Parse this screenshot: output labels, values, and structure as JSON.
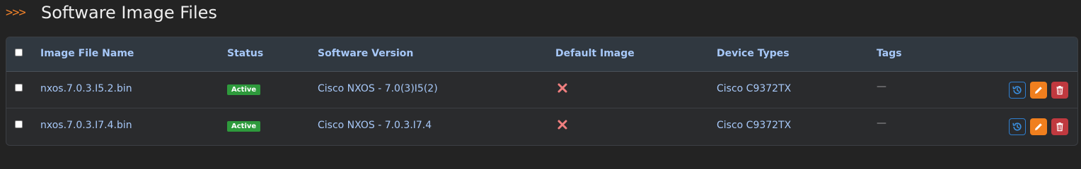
{
  "header": {
    "chevrons": ">>>",
    "title": "Software Image Files"
  },
  "table": {
    "columns": [
      "Image File Name",
      "Status",
      "Software Version",
      "Default Image",
      "Device Types",
      "Tags"
    ],
    "rows": [
      {
        "image_file_name": "nxos.7.0.3.I5.2.bin",
        "status": "Active",
        "software_version": "Cisco NXOS - 7.0(3)I5(2)",
        "default_image": false,
        "device_types": "Cisco C9372TX",
        "tags": "—"
      },
      {
        "image_file_name": "nxos.7.0.3.I7.4.bin",
        "status": "Active",
        "software_version": "Cisco NXOS - 7.0.3.I7.4",
        "default_image": false,
        "device_types": "Cisco C9372TX",
        "tags": "—"
      }
    ]
  },
  "colors": {
    "accent_orange": "#f0822a",
    "link_blue": "#a7c8f8",
    "status_active": "#2e9a3c",
    "default_false_x": "#f07f7f",
    "history_button_border": "#2f7fd0",
    "edit_button": "#f07f1e",
    "delete_button": "#c0393f"
  },
  "icons": {
    "row_actions": [
      "history-icon",
      "pencil-icon",
      "trash-icon"
    ],
    "default_image_false": "x-icon"
  }
}
